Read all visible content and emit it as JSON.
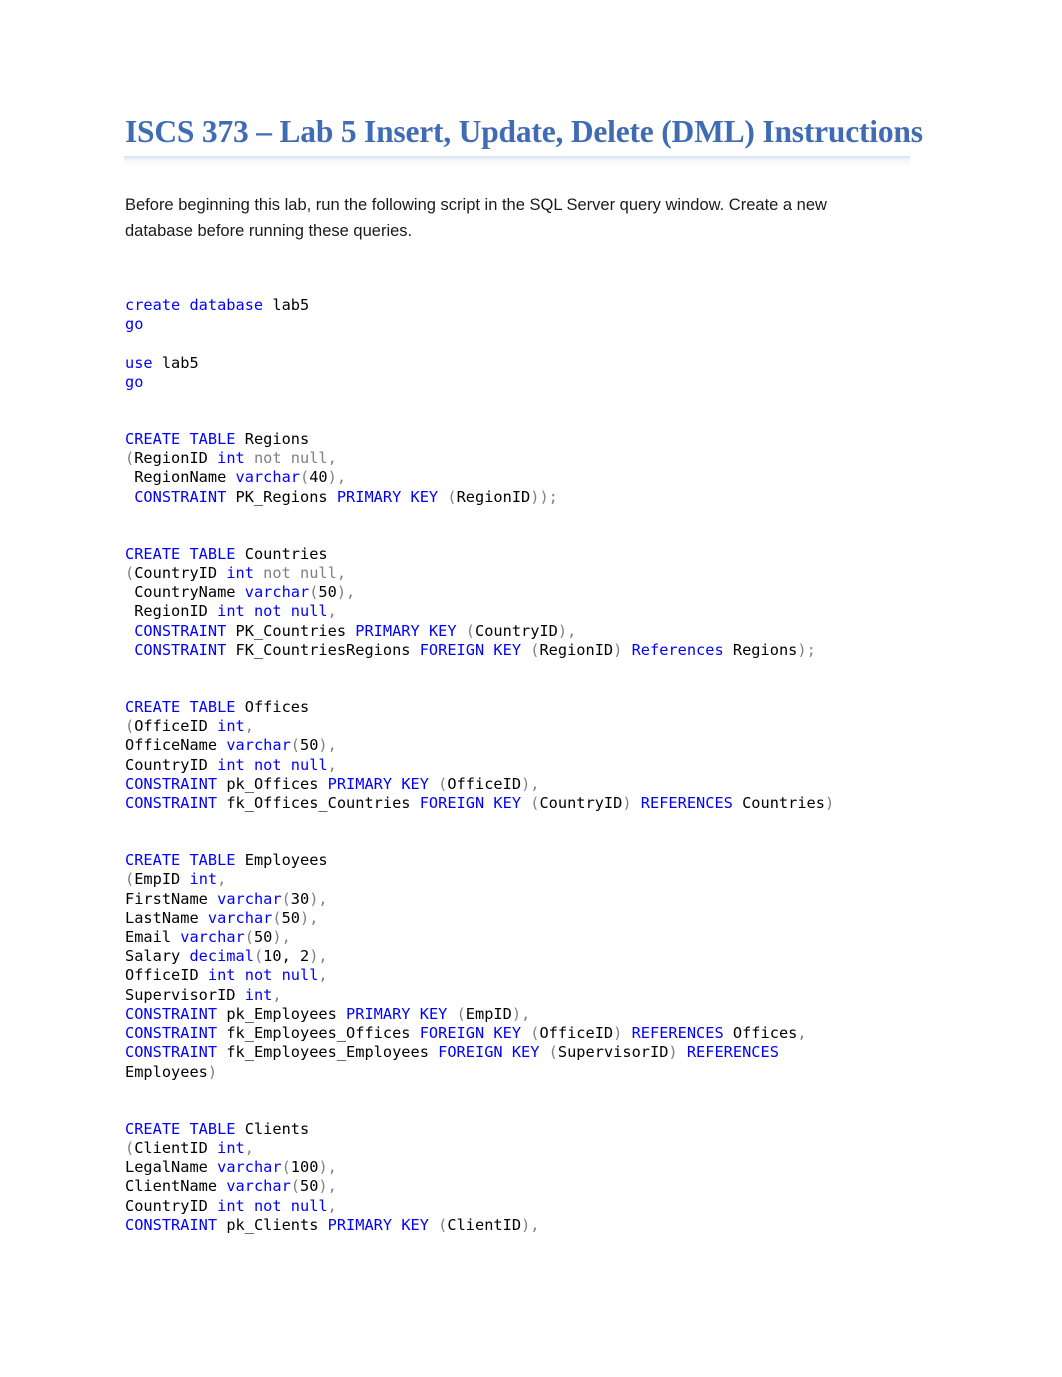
{
  "document": {
    "title": "ISCS 373 – Lab 5 Insert, Update, Delete (DML) Instructions",
    "title_color": "#3f6cb5",
    "intro": "Before beginning this lab, run the following script in the SQL Server query window.  Create a new database before running these queries.",
    "code_colors": {
      "keyword": "#0000ff",
      "punctuation": "#808080",
      "identifier": "#000000"
    },
    "code_blocks": [
      {
        "id": "create-database",
        "lines": [
          [
            [
              "create ",
              "k"
            ],
            [
              "database ",
              "k"
            ],
            [
              "lab5",
              "n"
            ]
          ],
          [
            [
              "go",
              "k"
            ]
          ],
          [
            [
              "",
              "n"
            ]
          ],
          [
            [
              "use ",
              "k"
            ],
            [
              "lab5",
              "n"
            ]
          ],
          [
            [
              "go",
              "k"
            ]
          ]
        ]
      },
      {
        "id": "create-table-regions",
        "lines": [
          [
            [
              "CREATE ",
              "k"
            ],
            [
              "TABLE ",
              "k"
            ],
            [
              "Regions",
              "n"
            ]
          ],
          [
            [
              "(",
              "g"
            ],
            [
              "RegionID ",
              "n"
            ],
            [
              "int ",
              "k"
            ],
            [
              "not null,",
              "g"
            ]
          ],
          [
            [
              " RegionName ",
              "n"
            ],
            [
              "varchar",
              "k"
            ],
            [
              "(",
              "g"
            ],
            [
              "40",
              "n"
            ],
            [
              "),",
              "g"
            ]
          ],
          [
            [
              " CONSTRAINT ",
              "k"
            ],
            [
              "PK_Regions ",
              "n"
            ],
            [
              "PRIMARY ",
              "k"
            ],
            [
              "KEY ",
              "k"
            ],
            [
              "(",
              "g"
            ],
            [
              "RegionID",
              "n"
            ],
            [
              "));",
              "g"
            ]
          ]
        ]
      },
      {
        "id": "create-table-countries",
        "lines": [
          [
            [
              "CREATE ",
              "k"
            ],
            [
              "TABLE ",
              "k"
            ],
            [
              "Countries",
              "n"
            ]
          ],
          [
            [
              "(",
              "g"
            ],
            [
              "CountryID ",
              "n"
            ],
            [
              "int ",
              "k"
            ],
            [
              "not null,",
              "g"
            ]
          ],
          [
            [
              " CountryName ",
              "n"
            ],
            [
              "varchar",
              "k"
            ],
            [
              "(",
              "g"
            ],
            [
              "50",
              "n"
            ],
            [
              "),",
              "g"
            ]
          ],
          [
            [
              " RegionID ",
              "n"
            ],
            [
              "int not null",
              "k"
            ],
            [
              ",",
              "g"
            ]
          ],
          [
            [
              " CONSTRAINT ",
              "k"
            ],
            [
              "PK_Countries ",
              "n"
            ],
            [
              "PRIMARY ",
              "k"
            ],
            [
              "KEY ",
              "k"
            ],
            [
              "(",
              "g"
            ],
            [
              "CountryID",
              "n"
            ],
            [
              "),",
              "g"
            ]
          ],
          [
            [
              " CONSTRAINT ",
              "k"
            ],
            [
              "FK_CountriesRegions ",
              "n"
            ],
            [
              "FOREIGN ",
              "k"
            ],
            [
              "KEY ",
              "k"
            ],
            [
              "(",
              "g"
            ],
            [
              "RegionID",
              "n"
            ],
            [
              ") ",
              "g"
            ],
            [
              "References ",
              "k"
            ],
            [
              "Regions",
              "n"
            ],
            [
              ");",
              "g"
            ]
          ]
        ]
      },
      {
        "id": "create-table-offices",
        "lines": [
          [
            [
              "CREATE ",
              "k"
            ],
            [
              "TABLE ",
              "k"
            ],
            [
              "Offices",
              "n"
            ]
          ],
          [
            [
              "(",
              "g"
            ],
            [
              "OfficeID ",
              "n"
            ],
            [
              "int",
              "k"
            ],
            [
              ",",
              "g"
            ]
          ],
          [
            [
              "OfficeName ",
              "n"
            ],
            [
              "varchar",
              "k"
            ],
            [
              "(",
              "g"
            ],
            [
              "50",
              "n"
            ],
            [
              "),",
              "g"
            ]
          ],
          [
            [
              "CountryID ",
              "n"
            ],
            [
              "int not null",
              "k"
            ],
            [
              ",",
              "g"
            ]
          ],
          [
            [
              "CONSTRAINT ",
              "k"
            ],
            [
              "pk_Offices ",
              "n"
            ],
            [
              "PRIMARY ",
              "k"
            ],
            [
              "KEY ",
              "k"
            ],
            [
              "(",
              "g"
            ],
            [
              "OfficeID",
              "n"
            ],
            [
              "),",
              "g"
            ]
          ],
          [
            [
              "CONSTRAINT ",
              "k"
            ],
            [
              "fk_Offices_Countries ",
              "n"
            ],
            [
              "FOREIGN ",
              "k"
            ],
            [
              "KEY ",
              "k"
            ],
            [
              "(",
              "g"
            ],
            [
              "CountryID",
              "n"
            ],
            [
              ") ",
              "g"
            ],
            [
              "REFERENCES ",
              "k"
            ],
            [
              "Countries",
              "n"
            ],
            [
              ")",
              "g"
            ]
          ]
        ]
      },
      {
        "id": "create-table-employees",
        "lines": [
          [
            [
              "CREATE ",
              "k"
            ],
            [
              "TABLE ",
              "k"
            ],
            [
              "Employees",
              "n"
            ]
          ],
          [
            [
              "(",
              "g"
            ],
            [
              "EmpID ",
              "n"
            ],
            [
              "int",
              "k"
            ],
            [
              ",",
              "g"
            ]
          ],
          [
            [
              "FirstName ",
              "n"
            ],
            [
              "varchar",
              "k"
            ],
            [
              "(",
              "g"
            ],
            [
              "30",
              "n"
            ],
            [
              "),",
              "g"
            ]
          ],
          [
            [
              "LastName ",
              "n"
            ],
            [
              "varchar",
              "k"
            ],
            [
              "(",
              "g"
            ],
            [
              "50",
              "n"
            ],
            [
              "),",
              "g"
            ]
          ],
          [
            [
              "Email ",
              "n"
            ],
            [
              "varchar",
              "k"
            ],
            [
              "(",
              "g"
            ],
            [
              "50",
              "n"
            ],
            [
              "),",
              "g"
            ]
          ],
          [
            [
              "Salary ",
              "n"
            ],
            [
              "decimal",
              "k"
            ],
            [
              "(",
              "g"
            ],
            [
              "10, 2",
              "n"
            ],
            [
              "),",
              "g"
            ]
          ],
          [
            [
              "OfficeID ",
              "n"
            ],
            [
              "int not null",
              "k"
            ],
            [
              ",",
              "g"
            ]
          ],
          [
            [
              "SupervisorID ",
              "n"
            ],
            [
              "int",
              "k"
            ],
            [
              ",",
              "g"
            ]
          ],
          [
            [
              "CONSTRAINT ",
              "k"
            ],
            [
              "pk_Employees ",
              "n"
            ],
            [
              "PRIMARY ",
              "k"
            ],
            [
              "KEY ",
              "k"
            ],
            [
              "(",
              "g"
            ],
            [
              "EmpID",
              "n"
            ],
            [
              "),",
              "g"
            ]
          ],
          [
            [
              "CONSTRAINT ",
              "k"
            ],
            [
              "fk_Employees_Offices ",
              "n"
            ],
            [
              "FOREIGN ",
              "k"
            ],
            [
              "KEY ",
              "k"
            ],
            [
              "(",
              "g"
            ],
            [
              "OfficeID",
              "n"
            ],
            [
              ") ",
              "g"
            ],
            [
              "REFERENCES ",
              "k"
            ],
            [
              "Offices",
              "n"
            ],
            [
              ",",
              "g"
            ]
          ],
          [
            [
              "CONSTRAINT ",
              "k"
            ],
            [
              "fk_Employees_Employees ",
              "n"
            ],
            [
              "FOREIGN ",
              "k"
            ],
            [
              "KEY ",
              "k"
            ],
            [
              "(",
              "g"
            ],
            [
              "SupervisorID",
              "n"
            ],
            [
              ") ",
              "g"
            ],
            [
              "REFERENCES",
              "k"
            ]
          ],
          [
            [
              "Employees",
              "n"
            ],
            [
              ")",
              "g"
            ]
          ]
        ]
      },
      {
        "id": "create-table-clients",
        "lines": [
          [
            [
              "CREATE ",
              "k"
            ],
            [
              "TABLE ",
              "k"
            ],
            [
              "Clients",
              "n"
            ]
          ],
          [
            [
              "(",
              "g"
            ],
            [
              "ClientID ",
              "n"
            ],
            [
              "int",
              "k"
            ],
            [
              ",",
              "g"
            ]
          ],
          [
            [
              "LegalName ",
              "n"
            ],
            [
              "varchar",
              "k"
            ],
            [
              "(",
              "g"
            ],
            [
              "100",
              "n"
            ],
            [
              "),",
              "g"
            ]
          ],
          [
            [
              "ClientName ",
              "n"
            ],
            [
              "varchar",
              "k"
            ],
            [
              "(",
              "g"
            ],
            [
              "50",
              "n"
            ],
            [
              "),",
              "g"
            ]
          ],
          [
            [
              "CountryID ",
              "n"
            ],
            [
              "int not null",
              "k"
            ],
            [
              ",",
              "g"
            ]
          ],
          [
            [
              "CONSTRAINT ",
              "k"
            ],
            [
              "pk_Clients ",
              "n"
            ],
            [
              "PRIMARY ",
              "k"
            ],
            [
              "KEY ",
              "k"
            ],
            [
              "(",
              "g"
            ],
            [
              "ClientID",
              "n"
            ],
            [
              "),",
              "g"
            ]
          ]
        ]
      }
    ]
  }
}
